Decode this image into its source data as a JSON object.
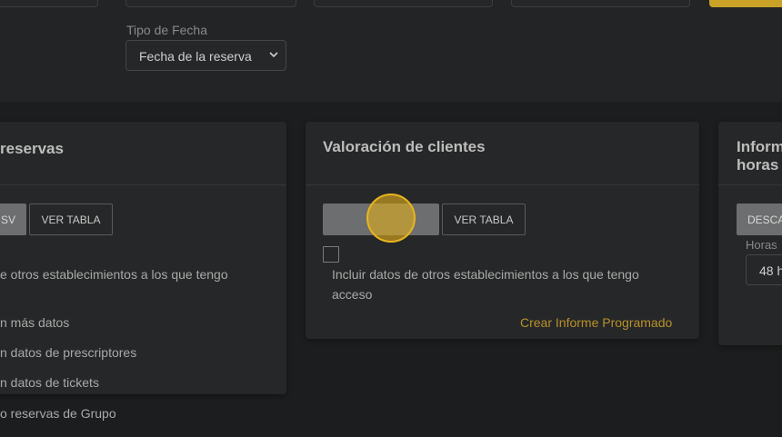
{
  "filters": {
    "date_type_label": "Tipo de Fecha",
    "date_type_value": "Fecha de la reserva"
  },
  "card_reservas": {
    "title": "reservas",
    "csv_btn": "SV",
    "table_btn": "VER TABLA",
    "include_text": "e otros establecimientos a los que tengo",
    "opt1": "n más datos",
    "opt2": "n datos de prescriptores",
    "opt3": "n datos de tickets",
    "opt4": "o reservas de Grupo"
  },
  "card_valoracion": {
    "title": "Valoración de clientes",
    "table_btn": "VER TABLA",
    "include_line1": "Incluir datos de otros establecimientos a los que tengo",
    "include_line2": "acceso",
    "schedule_link": "Crear Informe Programado"
  },
  "card_horas": {
    "title_line1": "Inform",
    "title_line2": "horas",
    "download_btn": "DESCA",
    "hours_label": "Horas",
    "hours_value": "48 h"
  },
  "colors": {
    "accent": "#c9a227",
    "cursor": "#deac1e"
  }
}
